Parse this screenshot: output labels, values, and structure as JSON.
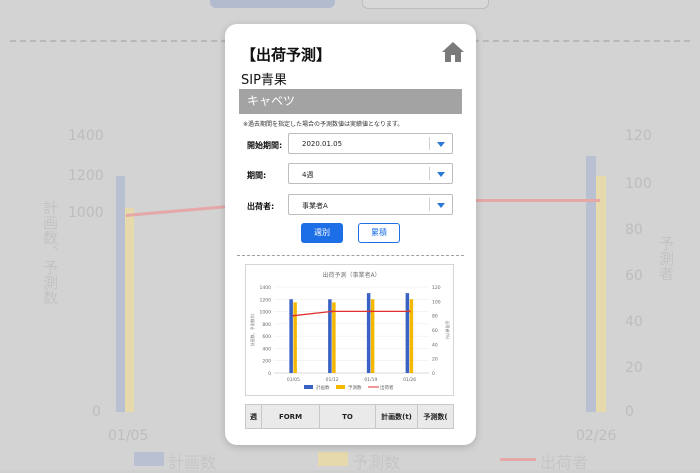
{
  "modal": {
    "title": "【出荷予測】",
    "subtitle": "SIP青果",
    "item": "キャベツ",
    "note": "※過去期間を指定した場合の予測数値は実績値となります。",
    "fields": [
      {
        "label": "開始期間:",
        "value": "2020.01.05"
      },
      {
        "label": "期間:",
        "value": "4週"
      },
      {
        "label": "出荷者:",
        "value": "事業者A"
      }
    ],
    "buttons": {
      "forecast": "週別",
      "cumulative": "累積"
    },
    "table_headers": [
      "週",
      "FORM",
      "TO",
      "計画数(t)",
      "予測数("
    ]
  },
  "background": {
    "left_ticks": [
      "1400",
      "1200",
      "1000",
      "0"
    ],
    "right_ticks": [
      "120",
      "100",
      "80",
      "60",
      "40",
      "20",
      "0"
    ],
    "y_label_left": "計画数、予測数",
    "y_label_right": "予測者",
    "x_labels": [
      "01/05",
      "02/26"
    ],
    "legend": [
      "計画数",
      "予測数",
      "出荷者"
    ]
  },
  "chart_data": {
    "type": "bar",
    "title": "出荷予測（事業者A）",
    "categories": [
      "01/05",
      "01/12",
      "01/19",
      "01/26"
    ],
    "y_ticks": [
      "1400",
      "1200",
      "1000",
      "800",
      "600",
      "400",
      "200",
      "0"
    ],
    "y2_ticks": [
      "120",
      "100",
      "80",
      "60",
      "40",
      "20",
      "0"
    ],
    "ylim": [
      0,
      1400
    ],
    "y2lim": [
      0,
      120
    ],
    "ylabel": "計画数、予測数(t)",
    "y2label": "出荷者(%)",
    "series": [
      {
        "name": "計画数",
        "type": "bar",
        "values": [
          1200,
          1200,
          1300,
          1300
        ],
        "color": "#3a62c4"
      },
      {
        "name": "予測数",
        "type": "bar",
        "values": [
          1150,
          1150,
          1200,
          1200
        ],
        "color": "#f5b800"
      },
      {
        "name": "出荷者",
        "type": "line",
        "axis": "right",
        "values": [
          80,
          86,
          86,
          86
        ],
        "color": "#e03131"
      }
    ],
    "legend_position": "bottom",
    "grid": true
  },
  "colors": {
    "primary": "#1c6fe6",
    "banner": "#a3a3a3",
    "arrow": "#2a79d6"
  }
}
